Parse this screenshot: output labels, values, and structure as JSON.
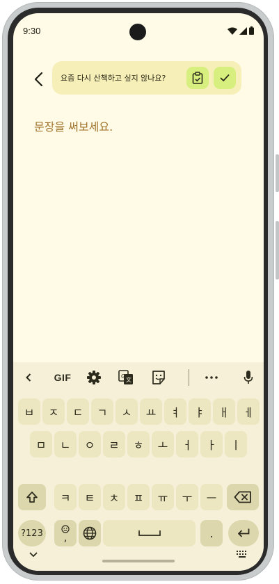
{
  "status_bar": {
    "time": "9:30"
  },
  "suggestion": {
    "text": "요즘 다시 산책하고 싶지 않나요?"
  },
  "editor": {
    "text": "문장을 써보세요."
  },
  "toolbar": {
    "gif_label": "GIF"
  },
  "keyboard": {
    "row1": [
      "ㅂ",
      "ㅈ",
      "ㄷ",
      "ㄱ",
      "ㅅ",
      "ㅛ",
      "ㅕ",
      "ㅑ",
      "ㅐ",
      "ㅔ"
    ],
    "row2": [
      "ㅁ",
      "ㄴ",
      "ㅇ",
      "ㄹ",
      "ㅎ",
      "ㅗ",
      "ㅓ",
      "ㅏ",
      "ㅣ"
    ],
    "row3": [
      "ㅋ",
      "ㅌ",
      "ㅊ",
      "ㅍ",
      "ㅠ",
      "ㅜ",
      "ㅡ"
    ],
    "symbols_label": "?123",
    "comma_label": ",",
    "period_label": "."
  }
}
